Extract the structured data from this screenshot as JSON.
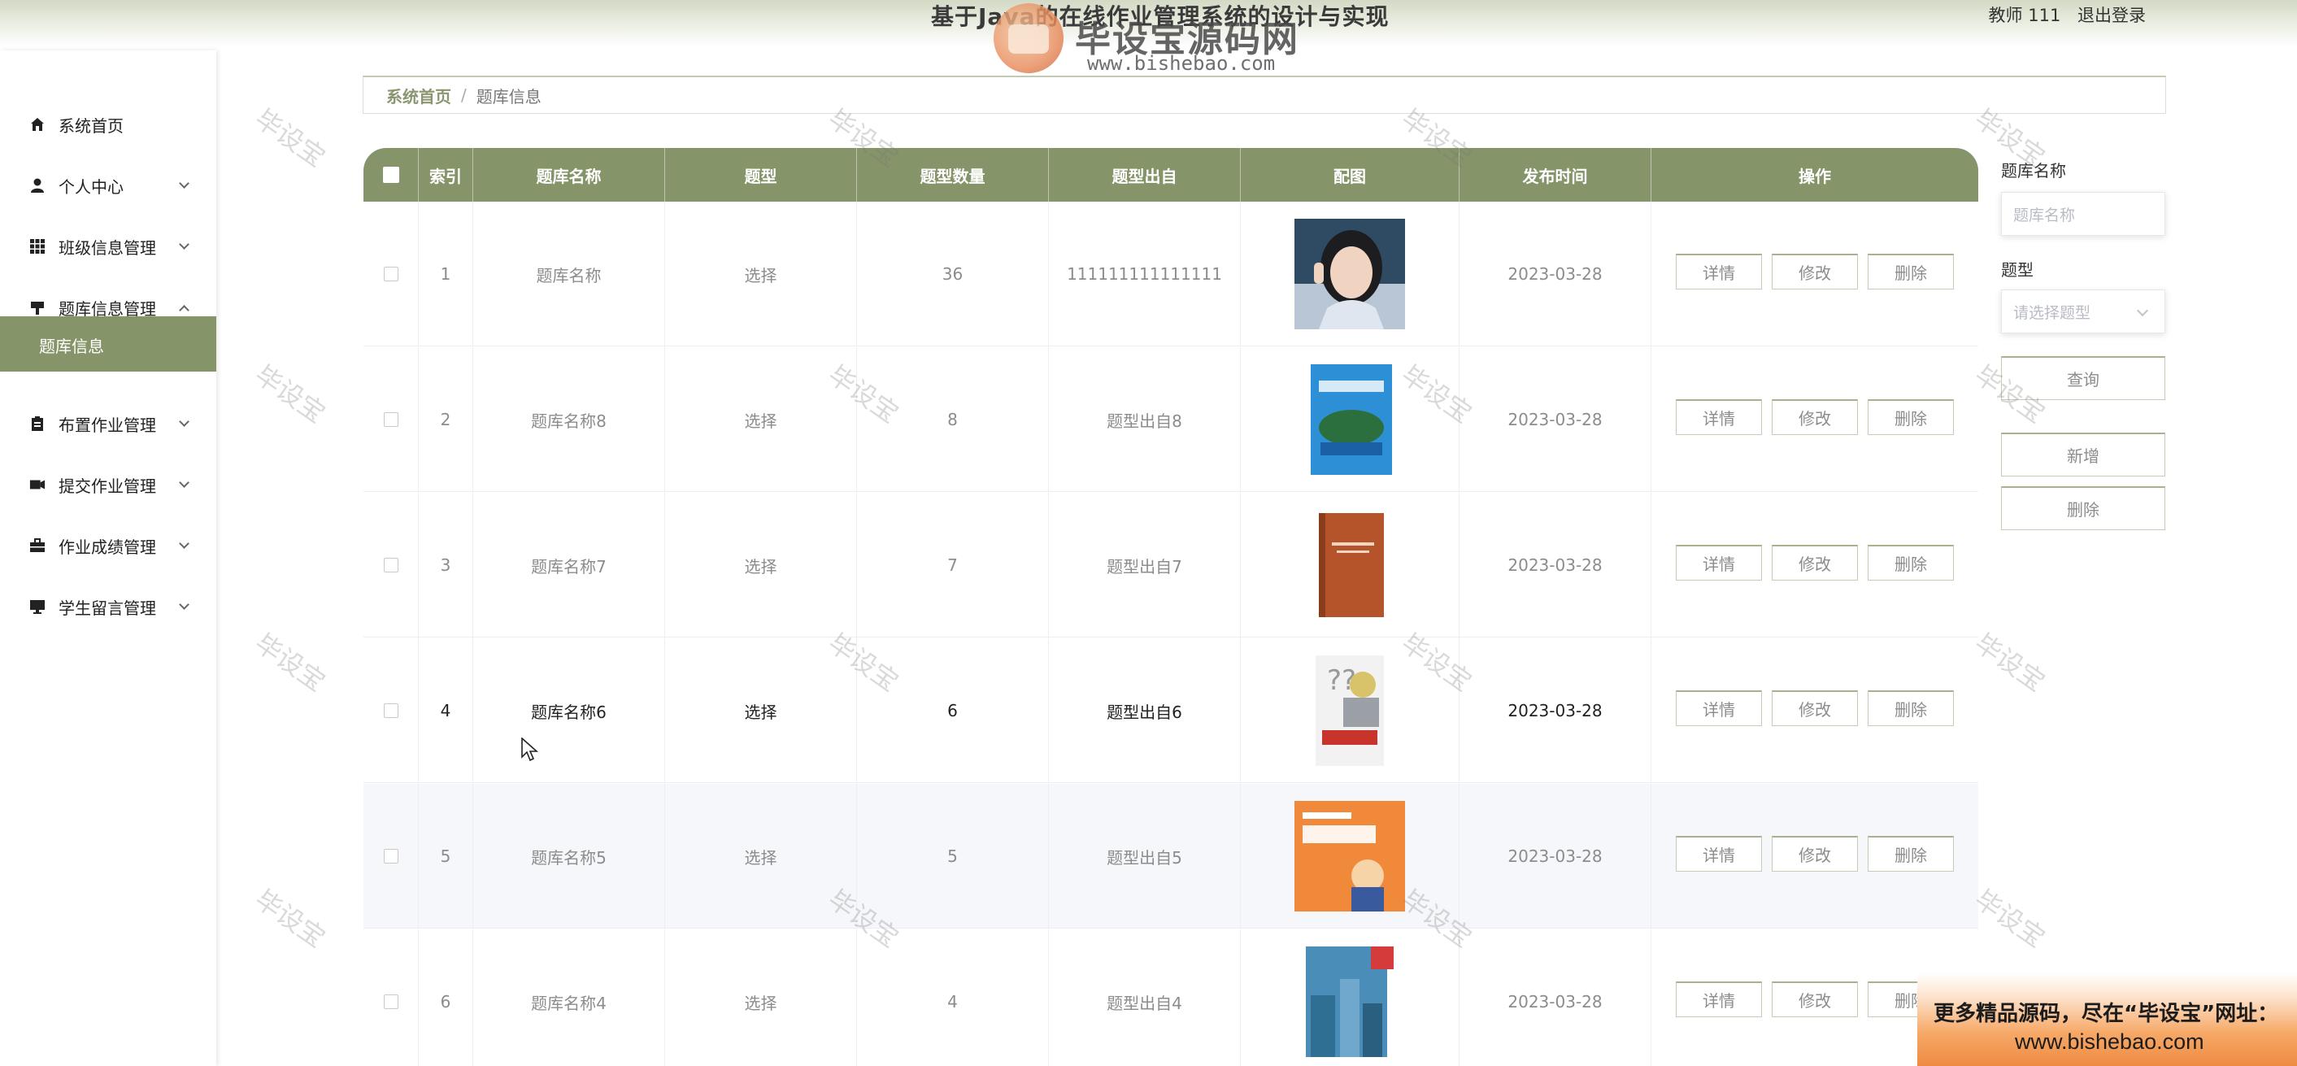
{
  "header": {
    "title": "基于Java的在线作业管理系统的设计与实现",
    "user_label": "教师 111",
    "logout_label": "退出登录"
  },
  "brand": {
    "name": "毕设宝源码网",
    "url": "www.bishebao.com"
  },
  "sidebar": {
    "items": [
      {
        "label": "系统首页",
        "icon": "home-icon",
        "expandable": false
      },
      {
        "label": "个人中心",
        "icon": "user-icon",
        "expandable": true
      },
      {
        "label": "班级信息管理",
        "icon": "grid-icon",
        "expandable": true
      },
      {
        "label": "题库信息管理",
        "icon": "pen-icon",
        "expandable": true,
        "expanded": true
      },
      {
        "label": "布置作业管理",
        "icon": "clipboard-icon",
        "expandable": true
      },
      {
        "label": "提交作业管理",
        "icon": "ticket-icon",
        "expandable": true
      },
      {
        "label": "作业成绩管理",
        "icon": "briefcase-icon",
        "expandable": true
      },
      {
        "label": "学生留言管理",
        "icon": "monitor-icon",
        "expandable": true
      }
    ],
    "active_sub": "题库信息"
  },
  "breadcrumb": {
    "home": "系统首页",
    "separator": "/",
    "current": "题库信息"
  },
  "table": {
    "columns": [
      "索引",
      "题库名称",
      "题型",
      "题型数量",
      "题型出自",
      "配图",
      "发布时间",
      "操作"
    ],
    "rows": [
      {
        "index": "1",
        "name": "题库名称",
        "type": "选择",
        "count": "36",
        "source": "111111111111111",
        "image": "photo-girl",
        "date": "2023-03-28"
      },
      {
        "index": "2",
        "name": "题库名称8",
        "type": "选择",
        "count": "8",
        "source": "题型出自8",
        "image": "book-blue",
        "date": "2023-03-28"
      },
      {
        "index": "3",
        "name": "题库名称7",
        "type": "选择",
        "count": "7",
        "source": "题型出自7",
        "image": "book-brown",
        "date": "2023-03-28"
      },
      {
        "index": "4",
        "name": "题库名称6",
        "type": "选择",
        "count": "6",
        "source": "题型出自6",
        "image": "book-gray",
        "date": "2023-03-28"
      },
      {
        "index": "5",
        "name": "题库名称5",
        "type": "选择",
        "count": "5",
        "source": "题型出自5",
        "image": "book-orange",
        "date": "2023-03-28"
      },
      {
        "index": "6",
        "name": "题库名称4",
        "type": "选择",
        "count": "4",
        "source": "题型出自4",
        "image": "book-math",
        "date": "2023-03-28"
      }
    ],
    "actions": {
      "detail": "详情",
      "edit": "修改",
      "delete": "删除"
    }
  },
  "search": {
    "name_label": "题库名称",
    "name_placeholder": "题库名称",
    "type_label": "题型",
    "type_placeholder": "请选择题型",
    "query_button": "查询",
    "add_button": "新增",
    "delete_button": "删除"
  },
  "watermark": "毕设宝",
  "promo": {
    "line1": "更多精品源码，尽在“毕设宝”网址：",
    "line2": "www.bishebao.com"
  },
  "colors": {
    "accent": "#86946a",
    "header_gradient_top": "#d2d9c4",
    "promo_orange": "#ee8b43"
  }
}
